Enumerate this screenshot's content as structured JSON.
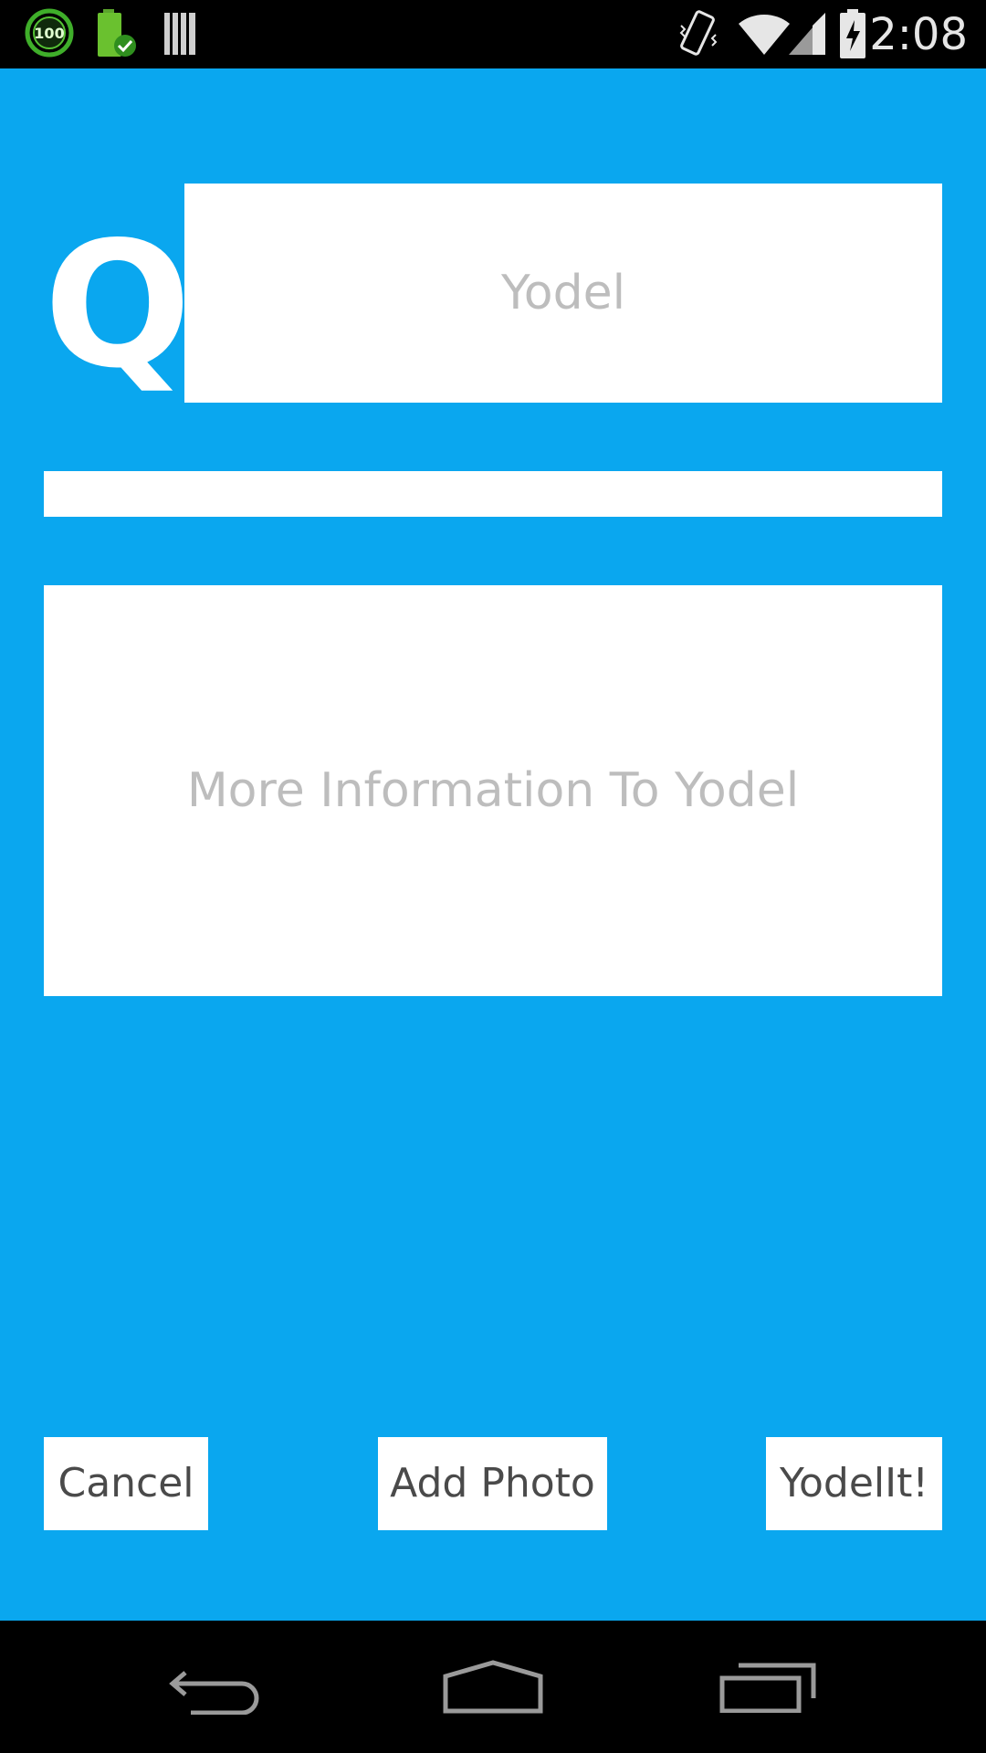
{
  "status_bar": {
    "time": "2:08",
    "icons": {
      "left": [
        "badge-100-icon",
        "battery-check-icon",
        "barcode-icon"
      ],
      "right": [
        "vibrate-icon",
        "wifi-icon",
        "signal-icon",
        "battery-charging-icon"
      ]
    },
    "badge_text": "100"
  },
  "compose": {
    "logo_letter": "Q",
    "title_placeholder": "Yodel",
    "title_value": "",
    "subtitle_value": "",
    "info_placeholder": "More Information To Yodel",
    "info_value": ""
  },
  "actions": {
    "cancel_label": "Cancel",
    "add_photo_label": "Add Photo",
    "yodel_label": "YodelIt!"
  },
  "nav": {
    "icons": [
      "back-icon",
      "home-icon",
      "recents-icon"
    ]
  },
  "colors": {
    "accent": "#0aa7ef",
    "surface": "#ffffff",
    "placeholder": "#bdbdbd",
    "button_text": "#4a4a4a"
  }
}
